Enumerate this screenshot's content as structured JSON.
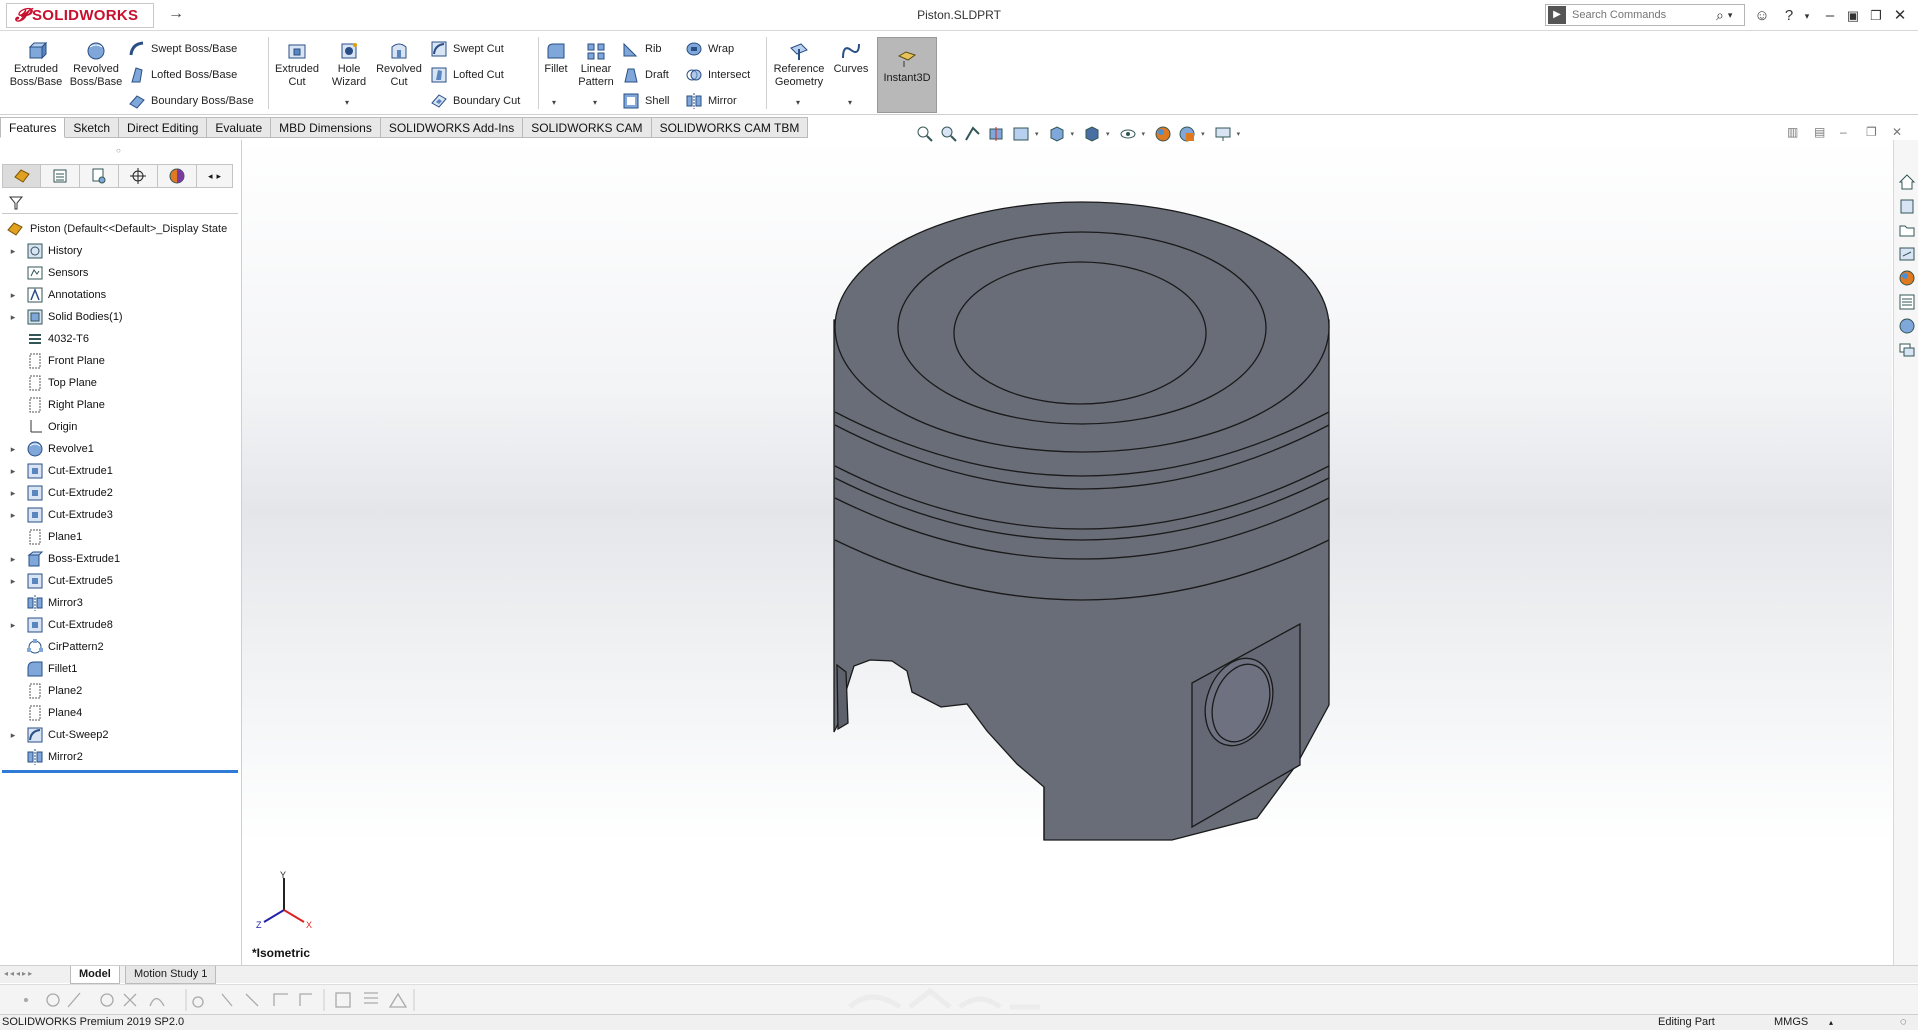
{
  "titlebar": {
    "brand": "SOLIDWORKS",
    "document_title": "Piston.SLDPRT",
    "search_placeholder": "Search Commands"
  },
  "commands": {
    "extruded_boss": "Extruded Boss/Base",
    "revolved_boss": "Revolved Boss/Base",
    "swept_boss": "Swept Boss/Base",
    "lofted_boss": "Lofted Boss/Base",
    "boundary_boss": "Boundary Boss/Base",
    "extruded_cut": "Extruded Cut",
    "hole_wizard": "Hole Wizard",
    "revolved_cut": "Revolved Cut",
    "swept_cut": "Swept Cut",
    "lofted_cut": "Lofted Cut",
    "boundary_cut": "Boundary Cut",
    "fillet": "Fillet",
    "linear_pattern": "Linear Pattern",
    "rib": "Rib",
    "draft": "Draft",
    "shell": "Shell",
    "wrap": "Wrap",
    "intersect": "Intersect",
    "mirror": "Mirror",
    "reference_geometry": "Reference Geometry",
    "curves": "Curves",
    "instant3d": "Instant3D"
  },
  "tabs": [
    "Features",
    "Sketch",
    "Direct Editing",
    "Evaluate",
    "MBD Dimensions",
    "SOLIDWORKS Add-Ins",
    "SOLIDWORKS CAM",
    "SOLIDWORKS CAM TBM"
  ],
  "tree": {
    "root": "Piston  (Default<<Default>_Display State",
    "items": [
      {
        "label": "History",
        "expand": true,
        "icon": "history-icon"
      },
      {
        "label": "Sensors",
        "expand": false,
        "icon": "sensors-icon"
      },
      {
        "label": "Annotations",
        "expand": true,
        "icon": "annotations-icon"
      },
      {
        "label": "Solid Bodies(1)",
        "expand": true,
        "icon": "solid-bodies-icon"
      },
      {
        "label": "4032-T6",
        "expand": false,
        "icon": "material-icon"
      },
      {
        "label": "Front Plane",
        "expand": false,
        "icon": "plane-icon"
      },
      {
        "label": "Top Plane",
        "expand": false,
        "icon": "plane-icon"
      },
      {
        "label": "Right Plane",
        "expand": false,
        "icon": "plane-icon"
      },
      {
        "label": "Origin",
        "expand": false,
        "icon": "origin-icon"
      },
      {
        "label": "Revolve1",
        "expand": true,
        "icon": "revolve-icon"
      },
      {
        "label": "Cut-Extrude1",
        "expand": true,
        "icon": "cut-extrude-icon"
      },
      {
        "label": "Cut-Extrude2",
        "expand": true,
        "icon": "cut-extrude-icon"
      },
      {
        "label": "Cut-Extrude3",
        "expand": true,
        "icon": "cut-extrude-icon"
      },
      {
        "label": "Plane1",
        "expand": false,
        "icon": "plane-icon"
      },
      {
        "label": "Boss-Extrude1",
        "expand": true,
        "icon": "boss-extrude-icon"
      },
      {
        "label": "Cut-Extrude5",
        "expand": true,
        "icon": "cut-extrude-icon"
      },
      {
        "label": "Mirror3",
        "expand": false,
        "icon": "mirror-icon"
      },
      {
        "label": "Cut-Extrude8",
        "expand": true,
        "icon": "cut-extrude-icon"
      },
      {
        "label": "CirPattern2",
        "expand": false,
        "icon": "circular-pattern-icon"
      },
      {
        "label": "Fillet1",
        "expand": false,
        "icon": "fillet-icon"
      },
      {
        "label": "Plane2",
        "expand": false,
        "icon": "plane-icon"
      },
      {
        "label": "Plane4",
        "expand": false,
        "icon": "plane-icon"
      },
      {
        "label": "Cut-Sweep2",
        "expand": true,
        "icon": "cut-sweep-icon"
      },
      {
        "label": "Mirror2",
        "expand": false,
        "icon": "mirror-icon"
      }
    ]
  },
  "viewport": {
    "view_name": "*Isometric",
    "triad": {
      "x": "X",
      "y": "Y",
      "z": "Z"
    }
  },
  "bottom_tabs": [
    "Model",
    "Motion Study 1"
  ],
  "status": {
    "product": "SOLIDWORKS Premium 2019 SP2.0",
    "mode": "Editing Part",
    "units": "MMGS"
  },
  "colors": {
    "brand_red": "#c8102e",
    "part_gray": "#696d78",
    "selection_blue": "#2f7bd6"
  }
}
